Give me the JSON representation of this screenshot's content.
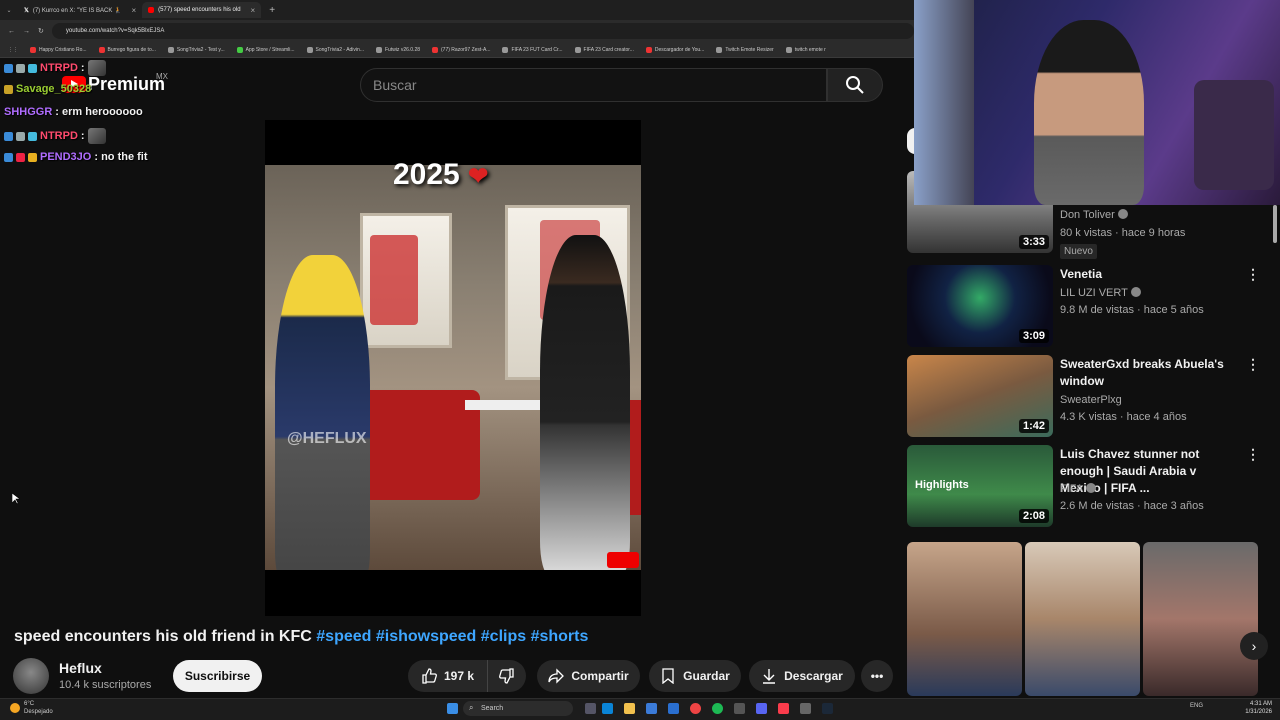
{
  "browser": {
    "tabs": [
      {
        "label": "(7) Kurrco en X: \"YE IS BACK 🧎",
        "active": false
      },
      {
        "label": "(577) speed encounters his old",
        "active": true
      }
    ],
    "url": "youtube.com/watch?v=Sqk5BlxEJSA",
    "bookmarks": [
      "Happy Cristiano Ro...",
      "Burrego figura de to...",
      "SongTrivia2 - Test y...",
      "App Store / Streamli...",
      "SongTrivia2 - Adivin...",
      "Futwiz v26.0.28",
      "(77) Razor97 Zest-A...",
      "FIFA 23 FUT Card Cr...",
      "FIFA 23 Card creator...",
      "Descargador de You...",
      "Twitch Emote Resizer",
      "twitch emote r"
    ]
  },
  "youtube": {
    "logo_text": "Premium",
    "country": "MX",
    "search_placeholder": "Buscar"
  },
  "chat": [
    {
      "user": "NTRPD",
      "message": ":",
      "color": "#ff4b6e"
    },
    {
      "user": "Savage_50328",
      "message": "",
      "color": "#9acd32"
    },
    {
      "user": "SHHGGR",
      "message": ": erm heroooooo",
      "color": "#b06dff"
    },
    {
      "user": "NTRPD",
      "message": ":",
      "color": "#ff4b6e"
    },
    {
      "user": "PEND3JO",
      "message": ": no the fit",
      "color": "#b06dff"
    }
  ],
  "video": {
    "overlay_year": "2025",
    "watermark": "@HEFLUX",
    "title_main": "speed encounters his old friend in KFC",
    "hashtags": "#speed #ishowspeed #clips #shorts"
  },
  "channel": {
    "name": "Heflux",
    "subscribers": "10.4 k suscriptores",
    "subscribe_label": "Suscribirse"
  },
  "actions": {
    "likes": "197 k",
    "share": "Compartir",
    "save": "Guardar",
    "download": "Descargar"
  },
  "related": [
    {
      "title": "",
      "channel": "Don Toliver",
      "meta": "80 k vistas · hace 9 horas",
      "badge": "Nuevo",
      "duration": "3:33"
    },
    {
      "title": "Venetia",
      "channel": "LIL UZI VERT",
      "meta": "9.8 M de vistas · hace 5 años",
      "duration": "3:09"
    },
    {
      "title": "SweaterGxd breaks Abuela's window",
      "channel": "SweaterPlxg",
      "meta": "4.3 K vistas · hace 4 años",
      "duration": "1:42"
    },
    {
      "title": "Luis Chavez stunner not enough | Saudi Arabia v Mexico | FIFA ...",
      "channel": "FIFA",
      "meta": "2.6 M de vistas · hace 3 años",
      "duration": "2:08",
      "thumb_label": "Highlights"
    }
  ],
  "taskbar": {
    "weather_temp": "6°C",
    "weather_desc": "Despejado",
    "search": "Search",
    "lang": "ENG",
    "time": "4:31 AM",
    "date": "1/31/2026"
  }
}
